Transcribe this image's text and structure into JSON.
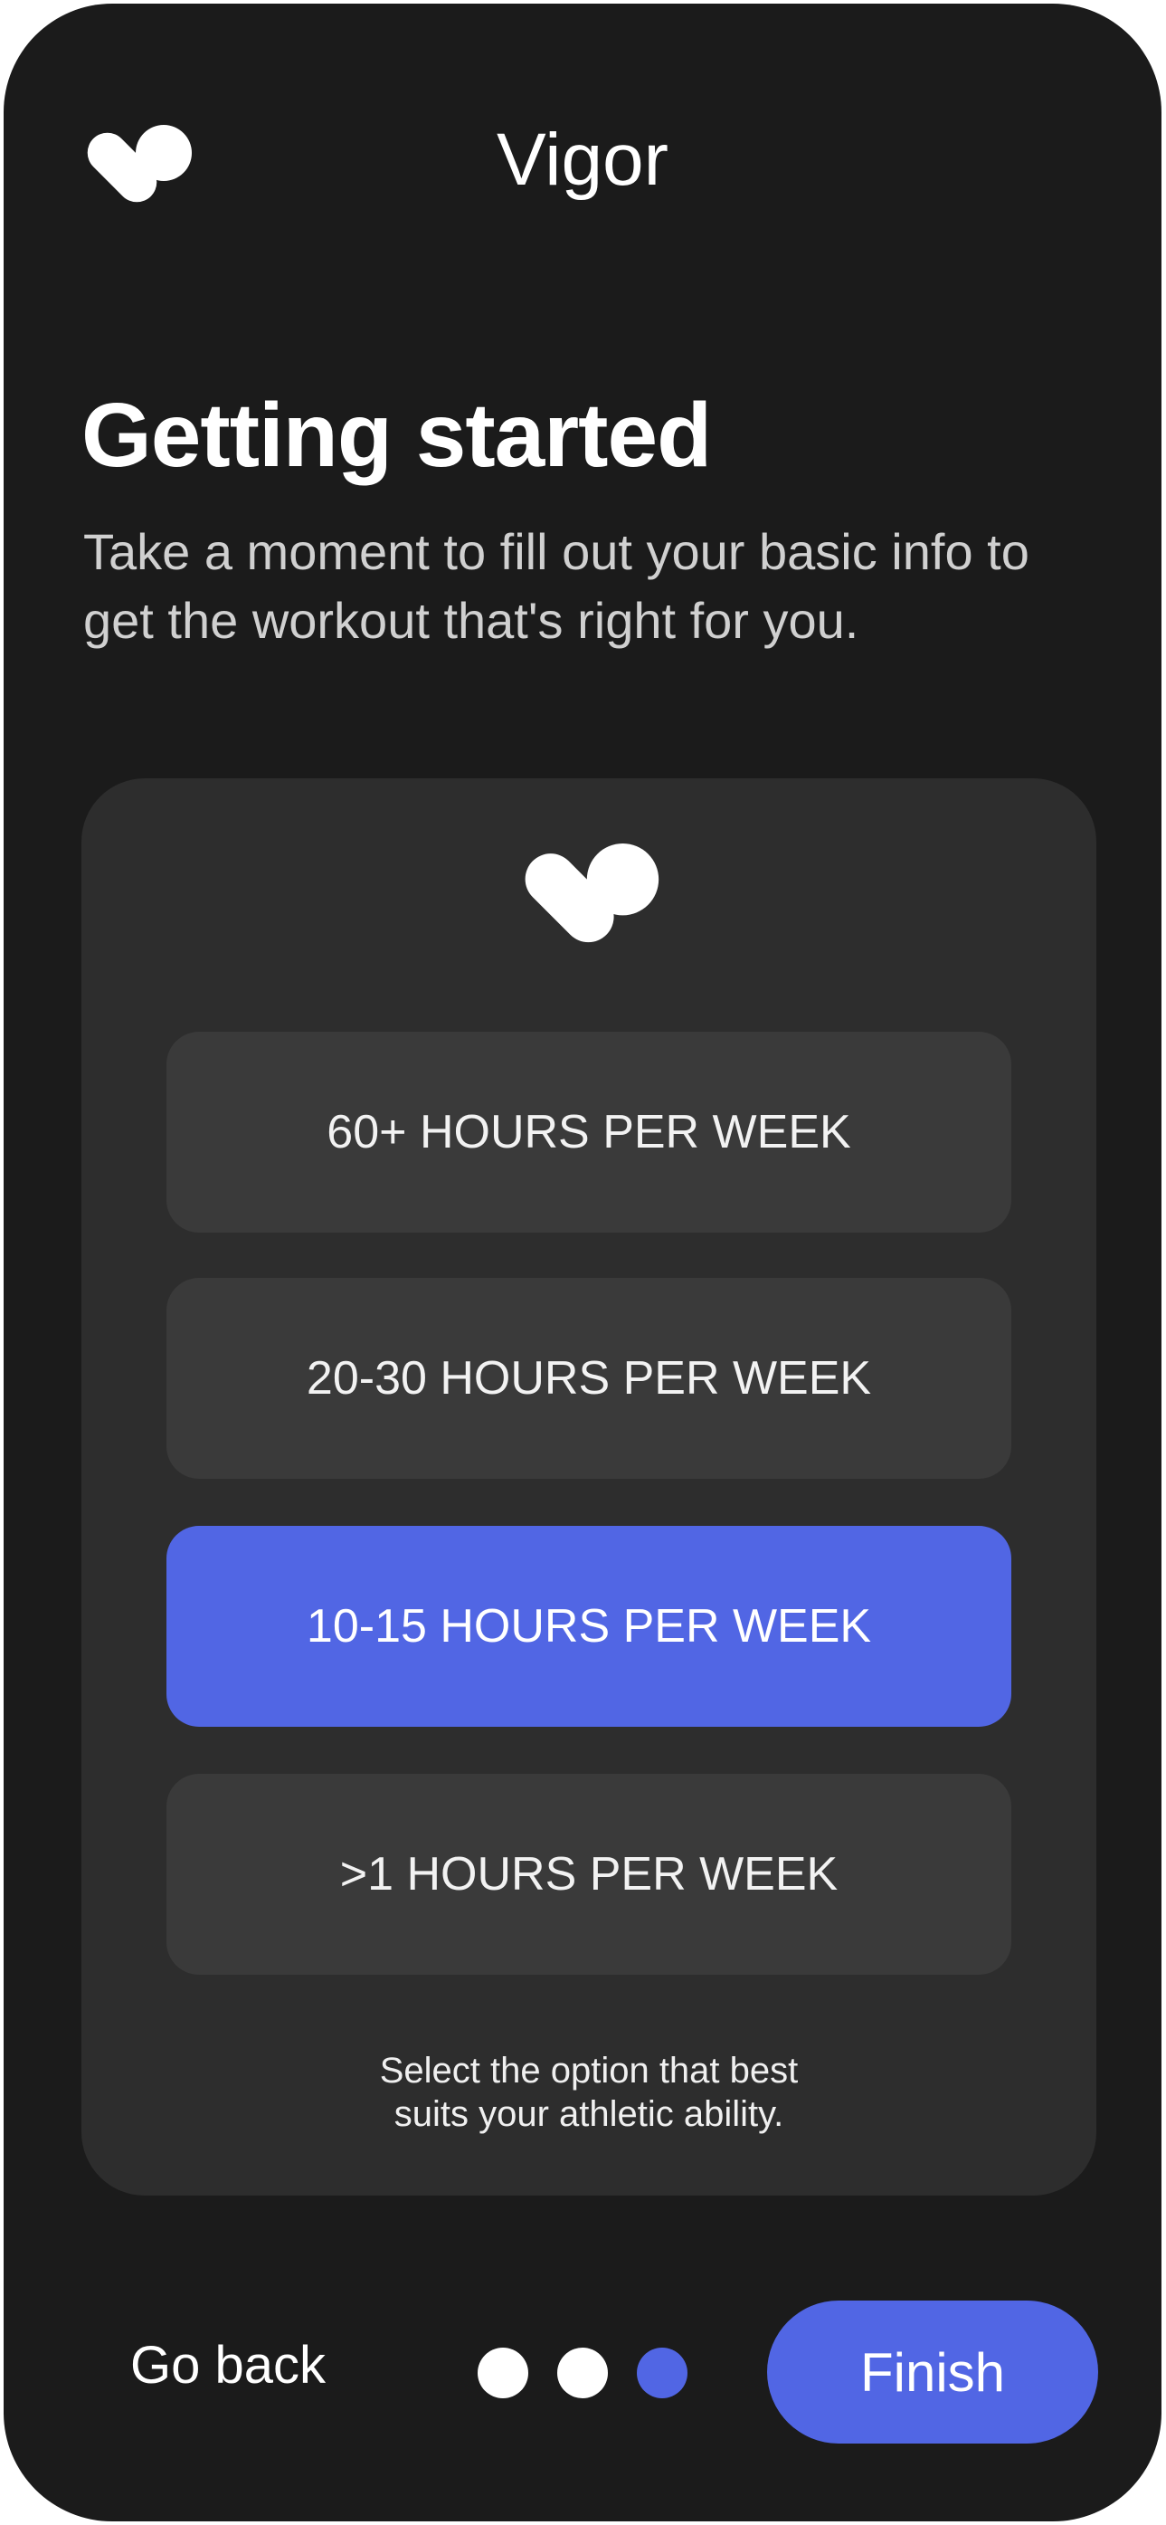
{
  "app": {
    "title": "Vigor"
  },
  "intro": {
    "heading": "Getting started",
    "subtitle": "Take a moment to fill out your basic info to get the workout that's right for you."
  },
  "options": [
    {
      "label": "60+ HOURS PER WEEK",
      "selected": false
    },
    {
      "label": "20-30 HOURS PER WEEK",
      "selected": false
    },
    {
      "label": "10-15 HOURS PER WEEK",
      "selected": true
    },
    {
      "label": ">1 HOURS PER WEEK",
      "selected": false
    }
  ],
  "hint": {
    "line1": "Select the option that best",
    "line2": "suits your athletic ability."
  },
  "footer": {
    "back_label": "Go back",
    "finish_label": "Finish",
    "progress": {
      "total_steps": 3,
      "current_step": 3
    }
  },
  "colors": {
    "background": "#1b1b1b",
    "card": "#2d2d2d",
    "option": "#3a3a3a",
    "accent": "#5166e4",
    "text": "#ffffff"
  },
  "icons": {
    "brand_logo": "vigor-logo-icon"
  }
}
